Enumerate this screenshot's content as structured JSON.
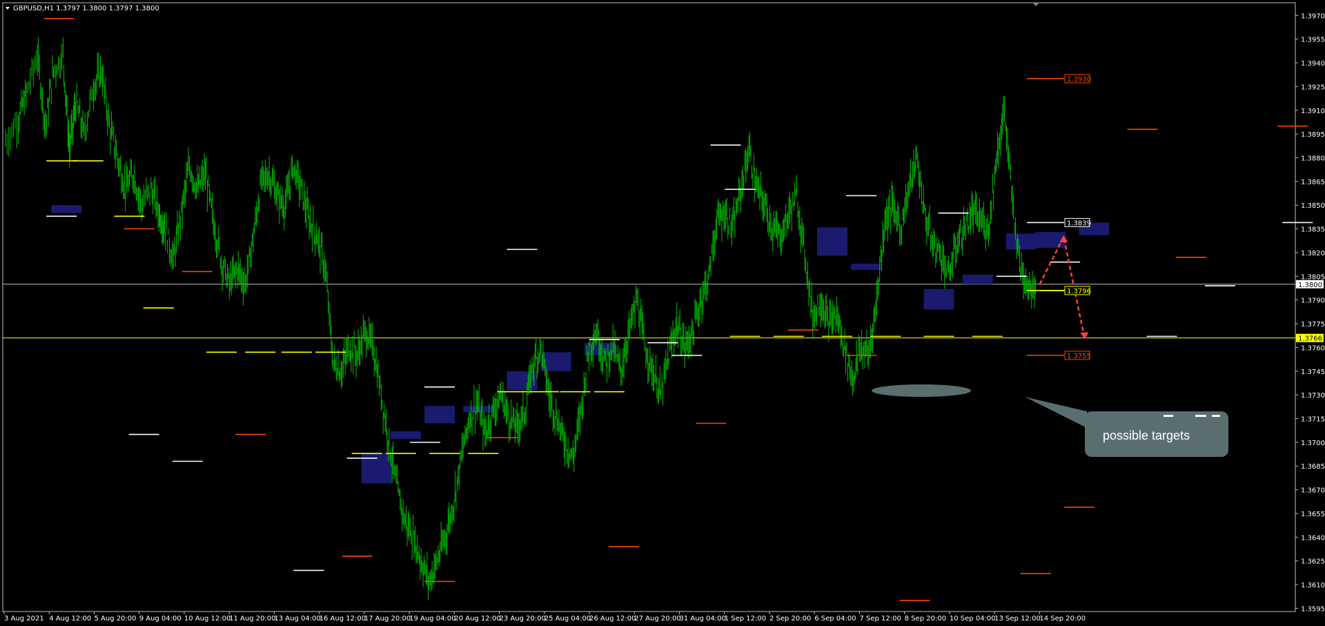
{
  "symbol_header": {
    "text": "GBPUSD,H1  1.3797 1.3800 1.3797 1.3800",
    "menu_icon": "triangle-down-icon"
  },
  "colors": {
    "background": "#000000",
    "candle": "#00c000",
    "frame": "#c0c0c0",
    "resistance": "#ff4500",
    "pivot": "#ffffff",
    "support_yellow": "#ffff00",
    "zone": "#1a1a6e",
    "arrow": "#ff4040",
    "callout": "#5a6e70"
  },
  "chart_data": {
    "type": "candlestick",
    "timeframe": "H1",
    "symbol": "GBPUSD",
    "ylim": [
      1.3593,
      1.3978
    ],
    "y_ticks": [
      "1.3970",
      "1.3955",
      "1.3940",
      "1.3925",
      "1.3910",
      "1.3895",
      "1.3880",
      "1.3865",
      "1.3850",
      "1.3835",
      "1.3820",
      "1.3805",
      "1.3790",
      "1.3775",
      "1.3760",
      "1.3745",
      "1.3730",
      "1.3715",
      "1.3700",
      "1.3685",
      "1.3670",
      "1.3655",
      "1.3640",
      "1.3625",
      "1.3610",
      "1.3595"
    ],
    "x_ticks": [
      "3 Aug 2021",
      "4 Aug 12:00",
      "5 Aug 20:00",
      "9 Aug 04:00",
      "10 Aug 12:00",
      "11 Aug 20:00",
      "13 Aug 04:00",
      "16 Aug 12:00",
      "17 Aug 20:00",
      "19 Aug 04:00",
      "20 Aug 12:00",
      "23 Aug 20:00",
      "25 Aug 04:00",
      "26 Aug 12:00",
      "27 Aug 20:00",
      "31 Aug 04:00",
      "1 Sep 12:00",
      "2 Sep 20:00",
      "6 Sep 04:00",
      "7 Sep 12:00",
      "8 Sep 20:00",
      "10 Sep 04:00",
      "13 Sep 12:00",
      "14 Sep 20:00"
    ],
    "price_path": [
      [
        0,
        1.389
      ],
      [
        0.8,
        1.3905
      ],
      [
        1.3,
        1.392
      ],
      [
        2,
        1.3945
      ],
      [
        2.5,
        1.39
      ],
      [
        3,
        1.3935
      ],
      [
        3.6,
        1.3945
      ],
      [
        4,
        1.3885
      ],
      [
        4.4,
        1.3915
      ],
      [
        4.9,
        1.3895
      ],
      [
        5.5,
        1.3925
      ],
      [
        6,
        1.3935
      ],
      [
        6.5,
        1.39
      ],
      [
        7,
        1.388
      ],
      [
        7.5,
        1.386
      ],
      [
        8,
        1.387
      ],
      [
        8.5,
        1.385
      ],
      [
        9.1,
        1.386
      ],
      [
        9.6,
        1.3845
      ],
      [
        10,
        1.3835
      ],
      [
        10.5,
        1.3815
      ],
      [
        11,
        1.3845
      ],
      [
        11.5,
        1.3875
      ],
      [
        12,
        1.386
      ],
      [
        12.5,
        1.387
      ],
      [
        13,
        1.384
      ],
      [
        13.5,
        1.3815
      ],
      [
        14,
        1.38
      ],
      [
        14.5,
        1.381
      ],
      [
        15,
        1.38
      ],
      [
        15.5,
        1.383
      ],
      [
        16,
        1.3865
      ],
      [
        16.5,
        1.387
      ],
      [
        17,
        1.3855
      ],
      [
        17.5,
        1.385
      ],
      [
        18,
        1.3875
      ],
      [
        18.5,
        1.386
      ],
      [
        19,
        1.384
      ],
      [
        19.5,
        1.383
      ],
      [
        20,
        1.381
      ],
      [
        20.5,
        1.375
      ],
      [
        21,
        1.3745
      ],
      [
        21.5,
        1.376
      ],
      [
        22,
        1.3755
      ],
      [
        22.5,
        1.377
      ],
      [
        23,
        1.376
      ],
      [
        23.5,
        1.373
      ],
      [
        24,
        1.37
      ],
      [
        24.5,
        1.367
      ],
      [
        25,
        1.365
      ],
      [
        25.5,
        1.364
      ],
      [
        26,
        1.3625
      ],
      [
        26.5,
        1.3612
      ],
      [
        27,
        1.3625
      ],
      [
        27.5,
        1.364
      ],
      [
        28,
        1.366
      ],
      [
        28.5,
        1.369
      ],
      [
        29,
        1.3715
      ],
      [
        29.5,
        1.3725
      ],
      [
        30,
        1.3705
      ],
      [
        30.5,
        1.372
      ],
      [
        31,
        1.373
      ],
      [
        31.5,
        1.3715
      ],
      [
        32,
        1.371
      ],
      [
        32.5,
        1.372
      ],
      [
        33,
        1.375
      ],
      [
        33.5,
        1.376
      ],
      [
        34,
        1.373
      ],
      [
        34.5,
        1.3715
      ],
      [
        35,
        1.37
      ],
      [
        35.5,
        1.369
      ],
      [
        36,
        1.372
      ],
      [
        36.5,
        1.376
      ],
      [
        37,
        1.377
      ],
      [
        37.5,
        1.375
      ],
      [
        38,
        1.376
      ],
      [
        38.5,
        1.3745
      ],
      [
        39,
        1.377
      ],
      [
        39.5,
        1.379
      ],
      [
        40,
        1.376
      ],
      [
        40.5,
        1.3745
      ],
      [
        41,
        1.373
      ],
      [
        41.5,
        1.3755
      ],
      [
        42,
        1.3775
      ],
      [
        42.5,
        1.376
      ],
      [
        43,
        1.377
      ],
      [
        43.5,
        1.379
      ],
      [
        44,
        1.3805
      ],
      [
        44.5,
        1.384
      ],
      [
        45,
        1.3845
      ],
      [
        45.5,
        1.3835
      ],
      [
        46,
        1.386
      ],
      [
        46.5,
        1.3885
      ],
      [
        47,
        1.386
      ],
      [
        47.5,
        1.385
      ],
      [
        48,
        1.3835
      ],
      [
        48.5,
        1.383
      ],
      [
        49,
        1.3845
      ],
      [
        49.5,
        1.3855
      ],
      [
        50,
        1.382
      ],
      [
        50.5,
        1.378
      ],
      [
        51,
        1.379
      ],
      [
        51.5,
        1.3775
      ],
      [
        52,
        1.378
      ],
      [
        52.5,
        1.376
      ],
      [
        53,
        1.374
      ],
      [
        53.5,
        1.376
      ],
      [
        54,
        1.3755
      ],
      [
        54.5,
        1.379
      ],
      [
        55,
        1.384
      ],
      [
        55.5,
        1.385
      ],
      [
        56,
        1.3835
      ],
      [
        56.5,
        1.386
      ],
      [
        57,
        1.388
      ],
      [
        57.5,
        1.3845
      ],
      [
        58,
        1.3825
      ],
      [
        58.5,
        1.382
      ],
      [
        59,
        1.3805
      ],
      [
        59.5,
        1.3825
      ],
      [
        60,
        1.3835
      ],
      [
        60.5,
        1.3845
      ],
      [
        61,
        1.384
      ],
      [
        61.5,
        1.3835
      ],
      [
        62,
        1.388
      ],
      [
        62.5,
        1.391
      ],
      [
        63,
        1.385
      ],
      [
        63.5,
        1.381
      ],
      [
        64,
        1.38
      ],
      [
        64.5,
        1.3798
      ]
    ],
    "n_steps": 80,
    "horizontal_lines": [
      {
        "price": 1.38,
        "color": "#c0c0c0",
        "label": "1.3800"
      },
      {
        "price": 1.3766,
        "color": "#ffff00",
        "label": "1.3766"
      }
    ],
    "price_labels": [
      {
        "price": 1.393,
        "text": "1.3930",
        "color": "#ff4500"
      },
      {
        "price": 1.3839,
        "text": "1.3839",
        "color": "#ffffff"
      },
      {
        "price": 1.3796,
        "text": "1.3796",
        "color": "#ffff00"
      },
      {
        "price": 1.3755,
        "text": "1.3755",
        "color": "#ff4500"
      }
    ],
    "level_segments": [
      {
        "step": 0.85,
        "price": 1.3968,
        "color": "#ff4500"
      },
      {
        "step": 2.5,
        "price": 1.3835,
        "color": "#ff4500"
      },
      {
        "step": 3.7,
        "price": 1.3808,
        "color": "#ff4500"
      },
      {
        "step": 4.8,
        "price": 1.3705,
        "color": "#ff4500"
      },
      {
        "step": 7.0,
        "price": 1.3628,
        "color": "#ff4500"
      },
      {
        "step": 8.7,
        "price": 1.3612,
        "color": "#ff4500"
      },
      {
        "step": 10.0,
        "price": 1.3703,
        "color": "#ff4500"
      },
      {
        "step": 12.5,
        "price": 1.3634,
        "color": "#ff4500"
      },
      {
        "step": 14.3,
        "price": 1.3712,
        "color": "#ff4500"
      },
      {
        "step": 16.2,
        "price": 1.3771,
        "color": "#ff4500"
      },
      {
        "step": 17.4,
        "price": 1.3755,
        "color": "#ff4500"
      },
      {
        "step": 18.5,
        "price": 1.36,
        "color": "#ff4500"
      },
      {
        "step": 21.0,
        "price": 1.3617,
        "color": "#ff4500"
      },
      {
        "step": 21.9,
        "price": 1.3659,
        "color": "#ff4500"
      },
      {
        "step": 23.2,
        "price": 1.3898,
        "color": "#ff4500"
      },
      {
        "step": 24.2,
        "price": 1.3817,
        "color": "#ff4500"
      },
      {
        "step": 26.3,
        "price": 1.39,
        "color": "#ff4500"
      },
      {
        "step": 27.9,
        "price": 1.3861,
        "color": "#ff4500"
      },
      {
        "step": 28.2,
        "price": 1.3794,
        "color": "#ff4500"
      },
      {
        "step": 29.2,
        "price": 1.3832,
        "color": "#ff4500"
      },
      {
        "step": 30.0,
        "price": 1.3808,
        "color": "#ff4500"
      },
      {
        "step": 31.1,
        "price": 1.381,
        "color": "#ff4500"
      },
      {
        "step": 32.7,
        "price": 1.3778,
        "color": "#ff4500"
      },
      {
        "step": 33.5,
        "price": 1.374,
        "color": "#ff4500"
      },
      {
        "step": 34.1,
        "price": 1.3922,
        "color": "#ff4500"
      },
      {
        "step": 35.5,
        "price": 1.3888,
        "color": "#ff4500"
      },
      {
        "step": 36.3,
        "price": 1.3734,
        "color": "#ff4500"
      },
      {
        "step": 38.5,
        "price": 1.373,
        "color": "#ff4500"
      },
      {
        "step": 39.1,
        "price": 1.3888,
        "color": "#ff4500"
      },
      {
        "step": 39.6,
        "price": 1.3698,
        "color": "#ff4500"
      },
      {
        "step": 40.3,
        "price": 1.3852,
        "color": "#ff4500"
      },
      {
        "step": 41.5,
        "price": 1.373,
        "color": "#ff4500"
      },
      {
        "step": 0.9,
        "price": 1.3843,
        "color": "#ffffff"
      },
      {
        "step": 2.6,
        "price": 1.3705,
        "color": "#ffffff"
      },
      {
        "step": 3.5,
        "price": 1.3688,
        "color": "#ffffff"
      },
      {
        "step": 6.0,
        "price": 1.3619,
        "color": "#ffffff"
      },
      {
        "step": 7.1,
        "price": 1.369,
        "color": "#ffffff"
      },
      {
        "step": 8.4,
        "price": 1.37,
        "color": "#ffffff"
      },
      {
        "step": 8.7,
        "price": 1.3735,
        "color": "#ffffff"
      },
      {
        "step": 10.4,
        "price": 1.3822,
        "color": "#ffffff"
      },
      {
        "step": 12.1,
        "price": 1.3765,
        "color": "#ffffff"
      },
      {
        "step": 13.3,
        "price": 1.3763,
        "color": "#ffffff"
      },
      {
        "step": 13.8,
        "price": 1.3755,
        "color": "#ffffff"
      },
      {
        "step": 14.6,
        "price": 1.3888,
        "color": "#ffffff"
      },
      {
        "step": 14.9,
        "price": 1.386,
        "color": "#ffffff"
      },
      {
        "step": 17.4,
        "price": 1.3856,
        "color": "#ffffff"
      },
      {
        "step": 19.3,
        "price": 1.3845,
        "color": "#ffffff"
      },
      {
        "step": 20.5,
        "price": 1.3805,
        "color": "#ffffff"
      },
      {
        "step": 21.6,
        "price": 1.3814,
        "color": "#ffffff"
      },
      {
        "step": 23.6,
        "price": 1.3767,
        "color": "#ffffff"
      },
      {
        "step": 24.8,
        "price": 1.3799,
        "color": "#ffffff"
      },
      {
        "step": 26.4,
        "price": 1.3839,
        "color": "#ffffff"
      },
      {
        "step": 0.9,
        "price": 1.3878,
        "color": "#ffff00"
      },
      {
        "step": 1.45,
        "price": 1.3878,
        "color": "#ffff00"
      },
      {
        "step": 2.3,
        "price": 1.3843,
        "color": "#ffff00"
      },
      {
        "step": 2.9,
        "price": 1.3785,
        "color": "#ffff00"
      },
      {
        "step": 4.2,
        "price": 1.3757,
        "color": "#ffff00"
      },
      {
        "step": 5.0,
        "price": 1.3757,
        "color": "#ffff00"
      },
      {
        "step": 5.75,
        "price": 1.3757,
        "color": "#ffff00"
      },
      {
        "step": 6.45,
        "price": 1.3757,
        "color": "#ffff00"
      },
      {
        "step": 7.2,
        "price": 1.3693,
        "color": "#ffff00"
      },
      {
        "step": 7.9,
        "price": 1.3693,
        "color": "#ffff00"
      },
      {
        "step": 8.8,
        "price": 1.3693,
        "color": "#ffff00"
      },
      {
        "step": 9.6,
        "price": 1.3693,
        "color": "#ffff00"
      },
      {
        "step": 10.2,
        "price": 1.3732,
        "color": "#ffff00"
      },
      {
        "step": 10.85,
        "price": 1.3732,
        "color": "#ffff00"
      },
      {
        "step": 11.5,
        "price": 1.3732,
        "color": "#ffff00"
      },
      {
        "step": 12.2,
        "price": 1.3732,
        "color": "#ffff00"
      },
      {
        "step": 15.0,
        "price": 1.3767,
        "color": "#ffff00"
      },
      {
        "step": 15.9,
        "price": 1.3767,
        "color": "#ffff00"
      },
      {
        "step": 16.9,
        "price": 1.3767,
        "color": "#ffff00"
      },
      {
        "step": 17.9,
        "price": 1.3767,
        "color": "#ffff00"
      },
      {
        "step": 19.0,
        "price": 1.3767,
        "color": "#ffff00"
      },
      {
        "step": 20.0,
        "price": 1.3767,
        "color": "#ffff00"
      },
      {
        "step": 21.4,
        "price": 1.3796,
        "color": "#ffff00"
      }
    ],
    "zones": [
      {
        "step": 1.0,
        "top": 1.385,
        "bottom": 1.3845
      },
      {
        "step": 7.4,
        "top": 1.3693,
        "bottom": 1.3674
      },
      {
        "step": 8.0,
        "top": 1.3707,
        "bottom": 1.3702
      },
      {
        "step": 8.7,
        "top": 1.3723,
        "bottom": 1.3712
      },
      {
        "step": 9.5,
        "top": 1.3723,
        "bottom": 1.3719
      },
      {
        "step": 10.4,
        "top": 1.3745,
        "bottom": 1.3733
      },
      {
        "step": 11.1,
        "top": 1.3757,
        "bottom": 1.3745
      },
      {
        "step": 12.0,
        "top": 1.3763,
        "bottom": 1.3755
      },
      {
        "step": 16.8,
        "top": 1.3836,
        "bottom": 1.3818
      },
      {
        "step": 17.5,
        "top": 1.3813,
        "bottom": 1.3809
      },
      {
        "step": 19.0,
        "top": 1.3797,
        "bottom": 1.3784
      },
      {
        "step": 19.8,
        "top": 1.3806,
        "bottom": 1.38
      },
      {
        "step": 20.7,
        "top": 1.3832,
        "bottom": 1.3822
      },
      {
        "step": 21.3,
        "top": 1.3833,
        "bottom": 1.3823
      },
      {
        "step": 22.2,
        "top": 1.3839,
        "bottom": 1.3831
      }
    ],
    "arrow": {
      "points": [
        [
          64.7,
          1.38
        ],
        [
          66.2,
          1.383
        ],
        [
          67.5,
          1.3766
        ]
      ],
      "color": "#ff4040"
    },
    "callout": {
      "text": "possible targets",
      "color": "#5a6e70"
    }
  }
}
